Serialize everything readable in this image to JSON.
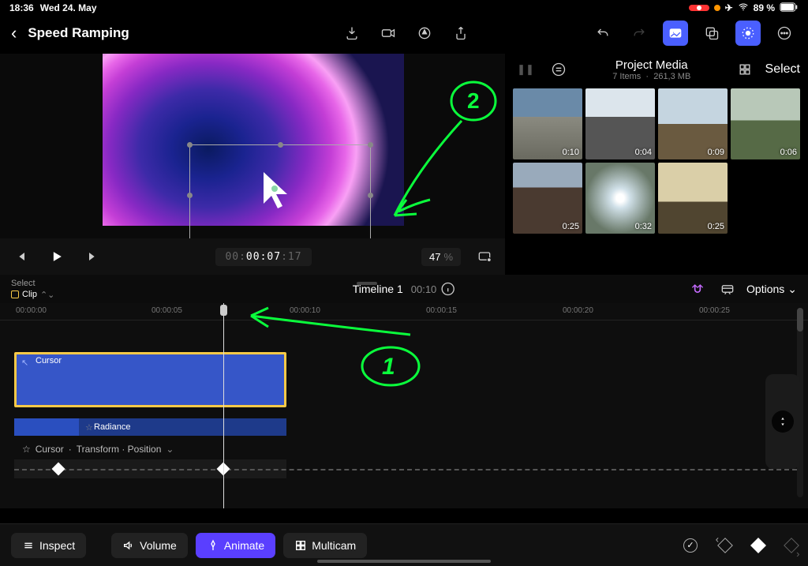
{
  "status": {
    "time": "18:36",
    "date": "Wed 24. May",
    "battery": "89 %"
  },
  "titlebar": {
    "title": "Speed Ramping"
  },
  "preview": {
    "timecode_dim1": "00:",
    "timecode_hl": "00:07",
    "timecode_dim2": ":17",
    "zoom_value": "47",
    "zoom_pct": "%"
  },
  "media": {
    "title": "Project Media",
    "subtitle_items": "7 Items",
    "subtitle_size": "261,3 MB",
    "select_label": "Select",
    "thumbs": [
      {
        "dur": "0:10"
      },
      {
        "dur": "0:04"
      },
      {
        "dur": "0:09"
      },
      {
        "dur": "0:06"
      },
      {
        "dur": "0:25"
      },
      {
        "dur": "0:32"
      },
      {
        "dur": "0:25"
      }
    ]
  },
  "timeline_head": {
    "select_label": "Select",
    "clip_label": "Clip",
    "name": "Timeline 1",
    "duration": "00:10",
    "options": "Options"
  },
  "ruler": {
    "marks": [
      "00:00:00",
      "00:00:05",
      "00:00:10",
      "00:00:15",
      "00:00:20",
      "00:00:25"
    ]
  },
  "tracks": {
    "cursor_clip": "Cursor",
    "radiance_clip": "Radiance",
    "kf_label_star": "☆",
    "kf_label_clip": "Cursor",
    "kf_label_sep": " · ",
    "kf_label_prop": "Transform · Position"
  },
  "bottom": {
    "inspect": "Inspect",
    "volume": "Volume",
    "animate": "Animate",
    "multicam": "Multicam"
  },
  "annotations": {
    "num1": "1",
    "num2": "2"
  }
}
